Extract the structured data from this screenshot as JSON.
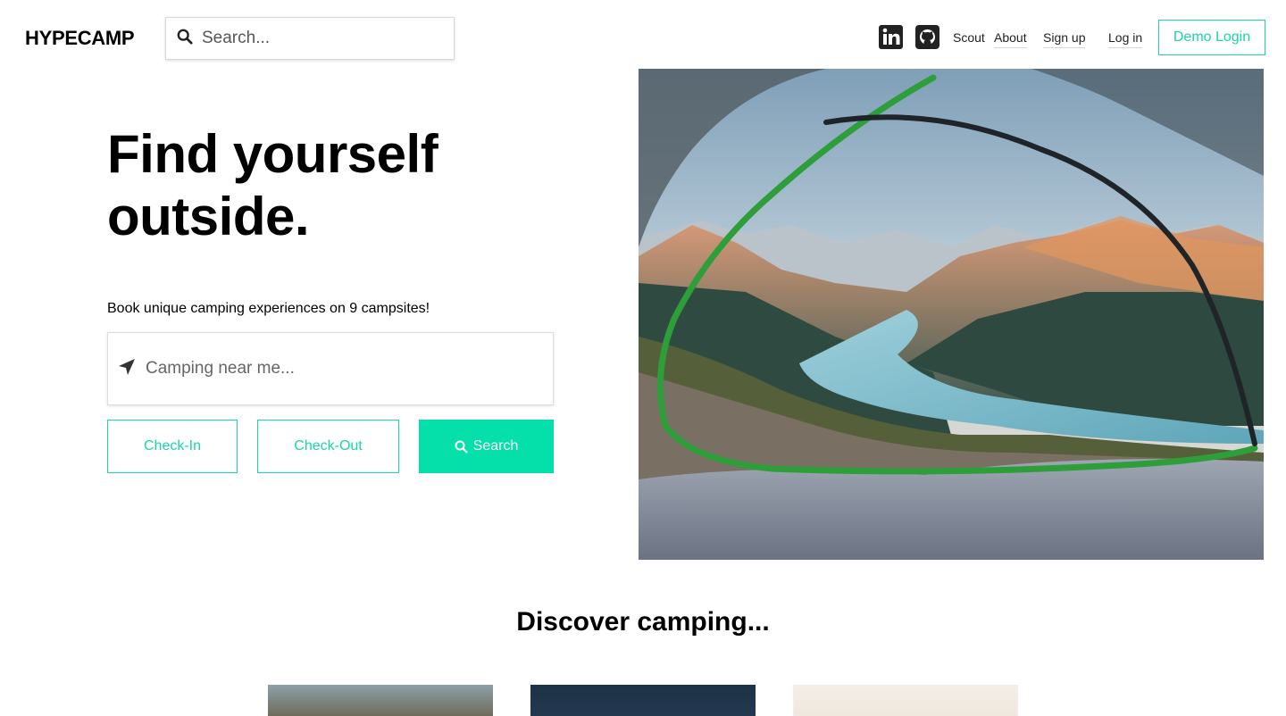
{
  "nav": {
    "logo": "HYPECAMP",
    "search_placeholder": "Search...",
    "icons": [
      "linkedin-icon",
      "github-icon"
    ],
    "links": [
      "Scout",
      "About",
      "Sign up",
      "Log in"
    ],
    "demo_login": "Demo Login"
  },
  "hero": {
    "title_line1": "Find yourself",
    "title_line2": "outside.",
    "subtitle": "Book unique camping experiences on 9 campsites!",
    "location_placeholder": "Camping near me...",
    "check_in": "Check-In",
    "check_out": "Check-Out",
    "search": "Search"
  },
  "discover": {
    "heading": "Discover camping..."
  },
  "colors": {
    "accent": "#1ad6a8",
    "accent_fill": "#05e0aa",
    "text": "#000000"
  }
}
